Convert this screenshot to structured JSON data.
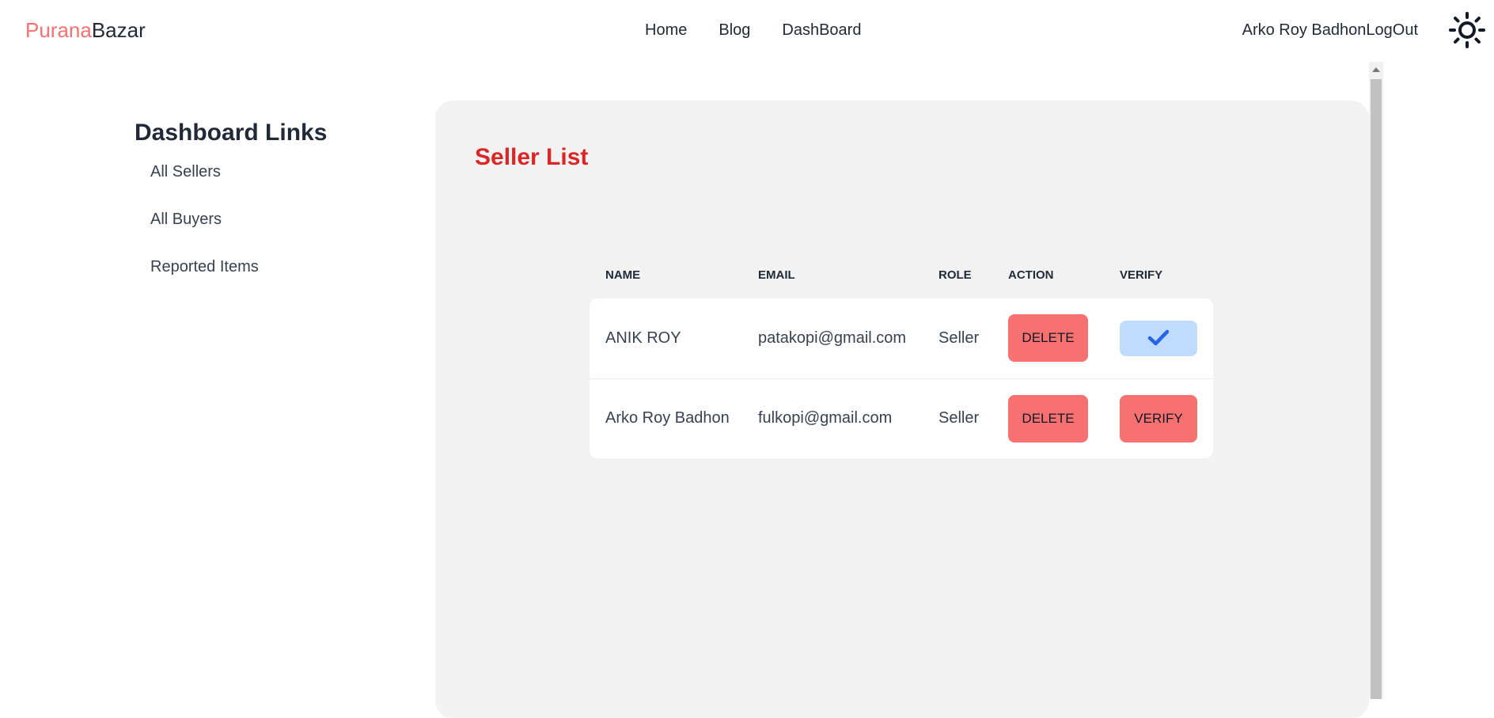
{
  "navbar": {
    "logo_part1": "Purana",
    "logo_part2": "Bazar",
    "links": [
      "Home",
      "Blog",
      "DashBoard"
    ],
    "user_name": "Arko Roy Badhon",
    "logout_label": "LogOut",
    "theme_icon": "sun-icon"
  },
  "sidebar": {
    "title": "Dashboard Links",
    "items": [
      "All Sellers",
      "All Buyers",
      "Reported Items"
    ]
  },
  "main": {
    "title": "Seller List",
    "table": {
      "headers": [
        "Name",
        "Email",
        "Role",
        "Action",
        "Verify"
      ],
      "rows": [
        {
          "name": "ANIK ROY",
          "email": "patakopi@gmail.com",
          "role": "Seller",
          "action_label": "DELETE",
          "verified": true,
          "verify_icon": "check-icon"
        },
        {
          "name": "Arko Roy Badhon",
          "email": "fulkopi@gmail.com",
          "role": "Seller",
          "action_label": "DELETE",
          "verified": false,
          "verify_label": "VERIFY"
        }
      ]
    }
  },
  "colors": {
    "brand_red": "#f87171",
    "title_red": "#dc2626",
    "verified_blue_bg": "#bfdbfe",
    "verified_check": "#2563eb",
    "panel_bg": "#f2f2f2"
  }
}
